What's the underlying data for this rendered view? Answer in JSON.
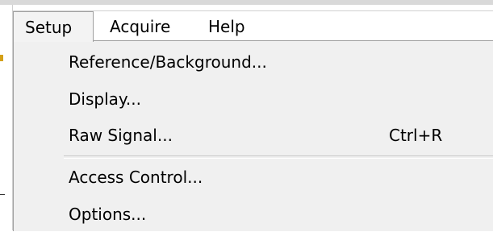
{
  "menubar": {
    "items": [
      {
        "label": "Setup",
        "active": true
      },
      {
        "label": "Acquire",
        "active": false
      },
      {
        "label": "Help",
        "active": false
      }
    ]
  },
  "setup_menu": {
    "items": [
      {
        "label": "Reference/Background...",
        "shortcut": ""
      },
      {
        "label": "Display...",
        "shortcut": ""
      },
      {
        "label": "Raw Signal...",
        "shortcut": "Ctrl+R"
      },
      {
        "label": "Access Control...",
        "shortcut": ""
      },
      {
        "label": "Options...",
        "shortcut": ""
      }
    ]
  }
}
